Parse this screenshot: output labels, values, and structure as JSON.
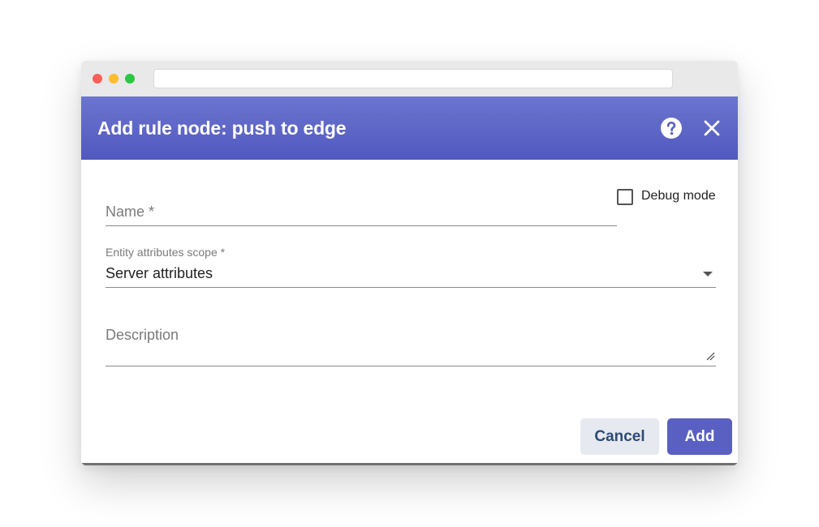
{
  "dialog": {
    "title": "Add rule node: push to edge",
    "help_icon": "help-circle-icon",
    "close_icon": "close-icon"
  },
  "form": {
    "name_label": "Name *",
    "debug_mode_label": "Debug mode",
    "debug_mode_checked": false,
    "scope_label": "Entity attributes scope *",
    "scope_value": "Server attributes",
    "description_label": "Description"
  },
  "actions": {
    "cancel_label": "Cancel",
    "add_label": "Add"
  },
  "colors": {
    "header": "#5b62c6",
    "primary": "#5a5fc2",
    "cancel_bg": "#e6e9ef",
    "cancel_text": "#2f4a78"
  }
}
